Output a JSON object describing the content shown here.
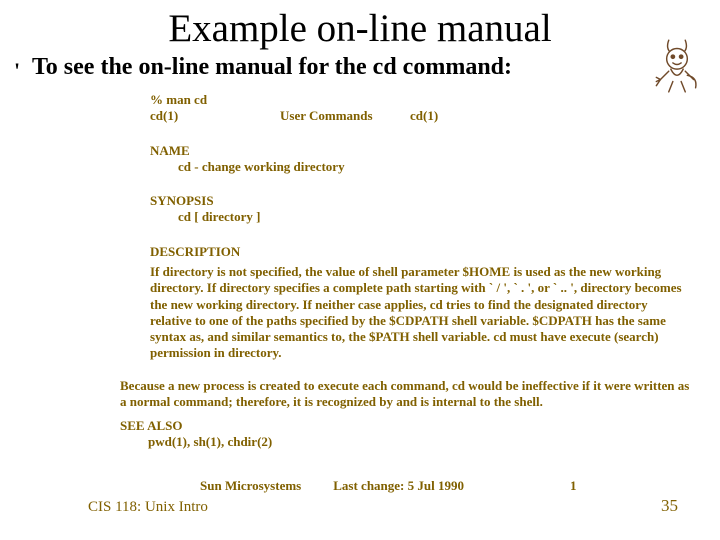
{
  "title": "Example on-line manual",
  "bullet": "'",
  "subtitle": "To see the on-line manual for the cd command:",
  "man": {
    "prompt": "% man cd",
    "header_left": "cd(1)",
    "header_center": "User Commands",
    "header_right": "cd(1)",
    "name_head": "NAME",
    "name_body": "cd - change working directory",
    "syn_head": "SYNOPSIS",
    "syn_body": "cd [ directory ]",
    "desc_head": "DESCRIPTION",
    "desc_p1": "If directory is not specified, the value of shell  parameter $HOME  is  used  as the new working  directory.  If directory specifies a complete path starting with ` / ', ` . ',  or  ` .. ', directory becomes the new working directory.  If neither case applies, cd tries to find the designated directory relative to one of the paths specified by the $CDPATH shell variable.  $CDPATH has the  same  syntax  as,  and similar semantics  to,  the $PATH shell variable.  cd must have execute (search) permission in directory.",
    "desc_p2": "Because a new process is created to execute each command, cd would be ineffective if it were written as a normal command; therefore, it is recognized by and is internal to the shell.",
    "see_head": "SEE ALSO",
    "see_body": "pwd(1), sh(1), chdir(2)",
    "foot_vendor": "Sun Microsystems",
    "foot_date": "Last change: 5 Jul 1990",
    "foot_page": "1"
  },
  "footer": {
    "left": "CIS 118: Unix Intro",
    "right": "35"
  }
}
